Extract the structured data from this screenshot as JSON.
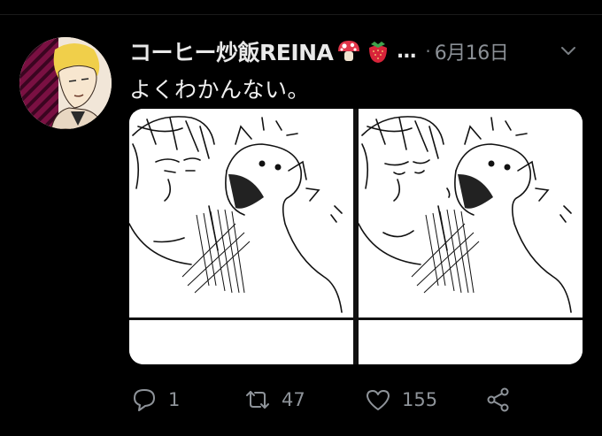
{
  "tweet": {
    "display_name": "コーヒー炒飯REINA",
    "name_emojis": [
      "mushroom-icon",
      "strawberry-icon"
    ],
    "name_truncation": "…",
    "separator": "·",
    "date": "6月16日",
    "text": "よくわかんない。"
  },
  "media": {
    "image_count": 2
  },
  "actions": {
    "reply_count": "1",
    "retweet_count": "47",
    "like_count": "155",
    "icons": [
      "reply-icon",
      "retweet-icon",
      "like-icon",
      "share-icon"
    ]
  },
  "colors": {
    "background": "#000000",
    "text_primary": "#e7e9ea",
    "text_secondary": "#8b9096",
    "icon": "#8e9399"
  }
}
